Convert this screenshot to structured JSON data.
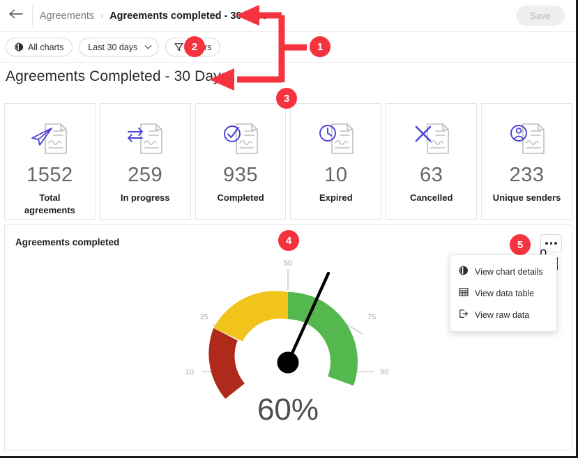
{
  "window": {
    "accent_red": "#f5333f",
    "brand_purple": "#4b3fd6"
  },
  "topbar": {
    "back_icon": "arrow-left-icon",
    "breadcrumb": {
      "root": "Agreements",
      "separator": "›",
      "current": "Agreements completed - 30 days"
    },
    "save_label": "Save"
  },
  "toolbar": {
    "all_charts_label": "All charts",
    "date_range_label": "Last 30 days",
    "date_range_caret": "chevron-down-icon",
    "filters_label": "Filters"
  },
  "page": {
    "title": "Agreements Completed - 30 Days"
  },
  "kpis": [
    {
      "value": "1552",
      "label": "Total agreements",
      "icon": "paper-plane-document-icon"
    },
    {
      "value": "259",
      "label": "In progress",
      "icon": "exchange-arrows-document-icon"
    },
    {
      "value": "935",
      "label": "Completed",
      "icon": "check-circle-document-icon"
    },
    {
      "value": "10",
      "label": "Expired",
      "icon": "clock-document-icon"
    },
    {
      "value": "63",
      "label": "Cancelled",
      "icon": "x-mark-document-icon"
    },
    {
      "value": "233",
      "label": "Unique senders",
      "icon": "user-circle-document-icon"
    }
  ],
  "chart_panel": {
    "title": "Agreements completed",
    "kebab_icon": "more-options-icon"
  },
  "menu": {
    "items": [
      {
        "label": "View chart details",
        "icon": "pie-chart-icon"
      },
      {
        "label": "View data table",
        "icon": "table-grid-icon"
      },
      {
        "label": "View raw data",
        "icon": "export-arrow-icon"
      }
    ]
  },
  "chart_data": {
    "type": "gauge",
    "title": "Agreements completed",
    "value": 60,
    "value_label": "60%",
    "unit": "%",
    "min": 0,
    "max": 100,
    "tick_labels": [
      "10",
      "25",
      "50",
      "75",
      "90"
    ],
    "ticks": [
      10,
      25,
      50,
      75,
      90
    ],
    "bands": [
      {
        "name": "low",
        "from": 0,
        "to": 25,
        "color": "#b02a1c"
      },
      {
        "name": "medium",
        "from": 25,
        "to": 50,
        "color": "#f0c41b"
      },
      {
        "name": "high",
        "from": 50,
        "to": 100,
        "color": "#55b84f"
      }
    ],
    "needle_color": "#000000",
    "legend": "none",
    "grid": false
  },
  "annotations": [
    {
      "id": "1",
      "label": "1"
    },
    {
      "id": "2",
      "label": "2"
    },
    {
      "id": "3",
      "label": "3"
    },
    {
      "id": "4",
      "label": "4"
    },
    {
      "id": "5",
      "label": "5"
    }
  ]
}
